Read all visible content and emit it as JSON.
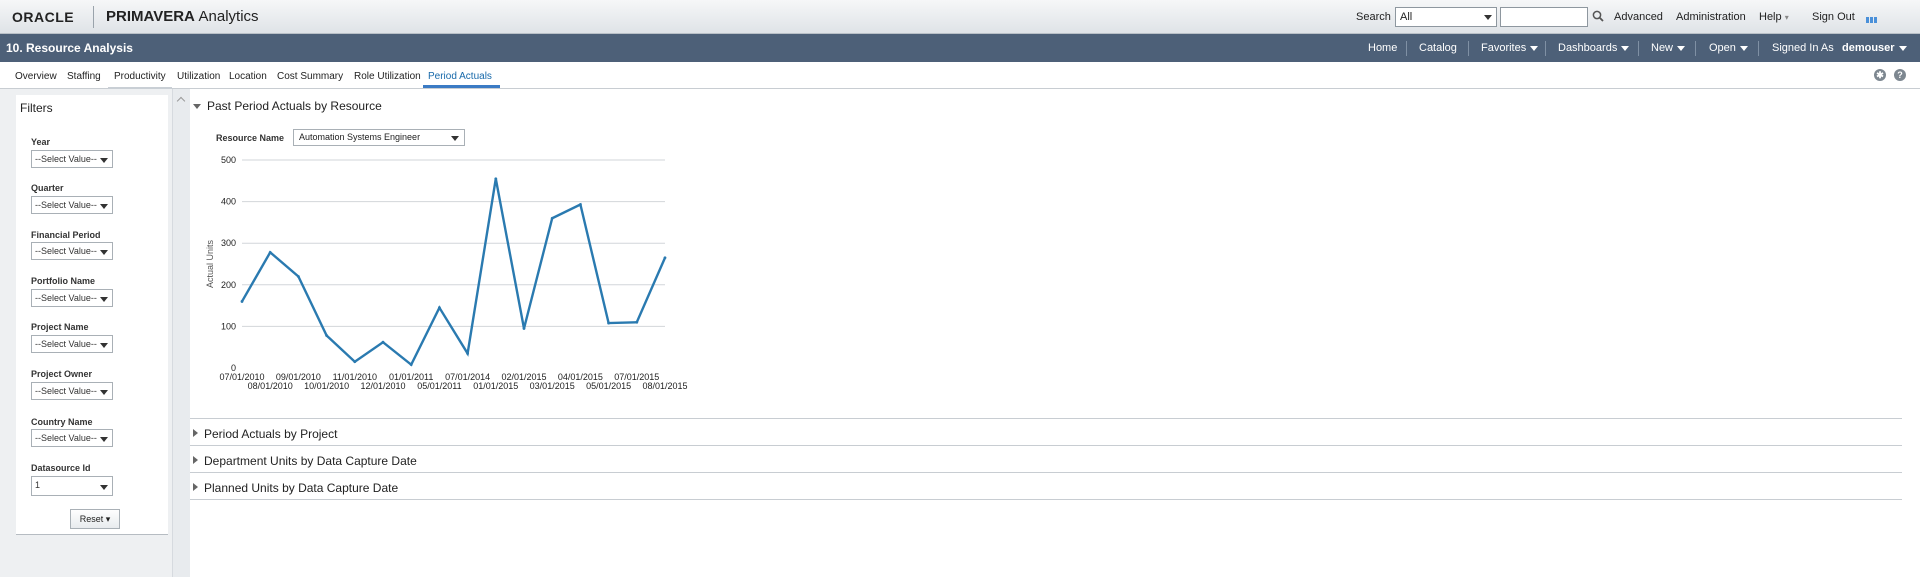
{
  "topbar": {
    "logo": "ORACLE",
    "product_bold": "PRIMAVERA",
    "product_rest": "Analytics",
    "search_label": "Search",
    "search_scope": "All",
    "search_value": "",
    "links": {
      "advanced": "Advanced",
      "administration": "Administration",
      "help": "Help",
      "sign_out": "Sign Out"
    }
  },
  "dashboard": {
    "title": "10. Resource Analysis",
    "nav": {
      "home": "Home",
      "catalog": "Catalog",
      "favorites": "Favorites",
      "dashboards": "Dashboards",
      "new": "New",
      "open": "Open",
      "signed_in_as": "Signed In As",
      "user": "demouser"
    }
  },
  "tabs": [
    "Overview",
    "Staffing",
    "Productivity",
    "Utilization",
    "Location",
    "Cost Summary",
    "Role Utilization",
    "Period Actuals"
  ],
  "active_tab": "Period Actuals",
  "filters": {
    "title": "Filters",
    "prompts": [
      {
        "label": "Year",
        "value": "--Select Value--"
      },
      {
        "label": "Quarter",
        "value": "--Select Value--"
      },
      {
        "label": "Financial Period",
        "value": "--Select Value--"
      },
      {
        "label": "Portfolio Name",
        "value": "--Select Value--"
      },
      {
        "label": "Project Name",
        "value": "--Select Value--"
      },
      {
        "label": "Project Owner",
        "value": "--Select Value--"
      },
      {
        "label": "Country Name",
        "value": "--Select Value--"
      },
      {
        "label": "Datasource Id",
        "value": "1"
      }
    ],
    "reset_label": "Reset"
  },
  "sections": [
    {
      "title_main": "Past Period Actuals",
      "title_suffix": "by Resource",
      "expanded": true
    },
    {
      "title_main": "Period Actuals",
      "title_suffix": "by Project",
      "expanded": false
    },
    {
      "title_main": "Department Units",
      "title_suffix": "by Data Capture Date",
      "expanded": false
    },
    {
      "title_main": "Planned Units",
      "title_suffix": "by Data Capture Date",
      "expanded": false
    }
  ],
  "resource_prompt": {
    "label": "Resource Name",
    "value": "Automation Systems Engineer"
  },
  "chart_data": {
    "type": "line",
    "title": "",
    "xlabel": "",
    "ylabel": "Actual Units",
    "ylim": [
      0,
      500
    ],
    "yticks": [
      0,
      100,
      200,
      300,
      400,
      500
    ],
    "grid": true,
    "line_color": "#2a7ab0",
    "x": [
      "07/01/2010",
      "08/01/2010",
      "09/01/2010",
      "10/01/2010",
      "11/01/2010",
      "12/01/2010",
      "01/01/2011",
      "05/01/2011",
      "07/01/2014",
      "01/01/2015",
      "02/01/2015",
      "03/01/2015",
      "04/01/2015",
      "05/01/2015",
      "07/01/2015",
      "08/01/2015"
    ],
    "series": [
      {
        "values": [
          160,
          278,
          220,
          78,
          15,
          62,
          8,
          145,
          35,
          455,
          95,
          360,
          393,
          108,
          110,
          265
        ]
      }
    ]
  }
}
